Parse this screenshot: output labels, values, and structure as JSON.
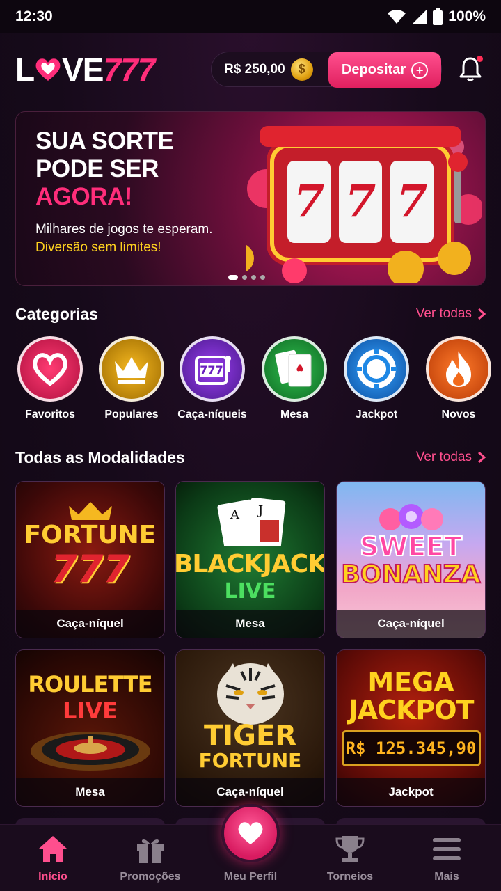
{
  "status_bar": {
    "time": "12:30",
    "battery": "100%"
  },
  "header": {
    "logo_left": "L",
    "logo_mid": "VE",
    "logo_num": "777",
    "balance": "R$ 250,00",
    "deposit_label": "Depositar"
  },
  "banner": {
    "line1": "SUA SORTE",
    "line2": "PODE SER",
    "line3": "AGORA!",
    "desc_white": "Milhares de jogos te esperam.",
    "desc_yellow": "Diversão sem limites!",
    "slot_digits": [
      "7",
      "7",
      "7"
    ]
  },
  "categories_section": {
    "title": "Categorias",
    "see_all": "Ver todas",
    "items": [
      {
        "label": "Favoritos",
        "icon": "heart-icon",
        "color": "#e0245e"
      },
      {
        "label": "Populares",
        "icon": "crown-icon",
        "color": "#e0a010"
      },
      {
        "label": "Caça-níqueis",
        "icon": "slot-machine-icon",
        "color": "#7b2fd6"
      },
      {
        "label": "Mesa",
        "icon": "playing-cards-icon",
        "color": "#1e9e3a"
      },
      {
        "label": "Jackpot",
        "icon": "poker-chip-icon",
        "color": "#1e88e5"
      },
      {
        "label": "Novos",
        "icon": "flame-icon",
        "color": "#f26a1b"
      }
    ]
  },
  "modes_section": {
    "title": "Todas as Modalidades",
    "see_all": "Ver todas",
    "games": [
      {
        "art1": "FORTUNE",
        "art2": "777",
        "caption": "Caça-níquel"
      },
      {
        "art1": "BLACKJACK",
        "art2": "LIVE",
        "caption": "Mesa"
      },
      {
        "art1": "SWEET",
        "art2": "BONANZA",
        "caption": "Caça-níquel"
      },
      {
        "art1": "ROULETTE",
        "art2": "LIVE",
        "caption": "Mesa"
      },
      {
        "art1": "TIGER",
        "art2": "FORTUNE",
        "caption": "Caça-níquel"
      },
      {
        "art1": "MEGA",
        "art2": "JACKPOT",
        "art3": "R$ 125.345,90",
        "caption": "Jackpot"
      }
    ]
  },
  "bottom_nav": {
    "items": [
      {
        "label": "Início",
        "icon": "home-icon"
      },
      {
        "label": "Promoções",
        "icon": "gift-icon"
      },
      {
        "label": "Meu Perfil",
        "icon": "heart-icon"
      },
      {
        "label": "Torneios",
        "icon": "trophy-icon"
      },
      {
        "label": "Mais",
        "icon": "menu-icon"
      }
    ]
  },
  "colors": {
    "accent": "#ff2d7a",
    "yellow": "#ffd21f",
    "background": "#160a1a"
  }
}
